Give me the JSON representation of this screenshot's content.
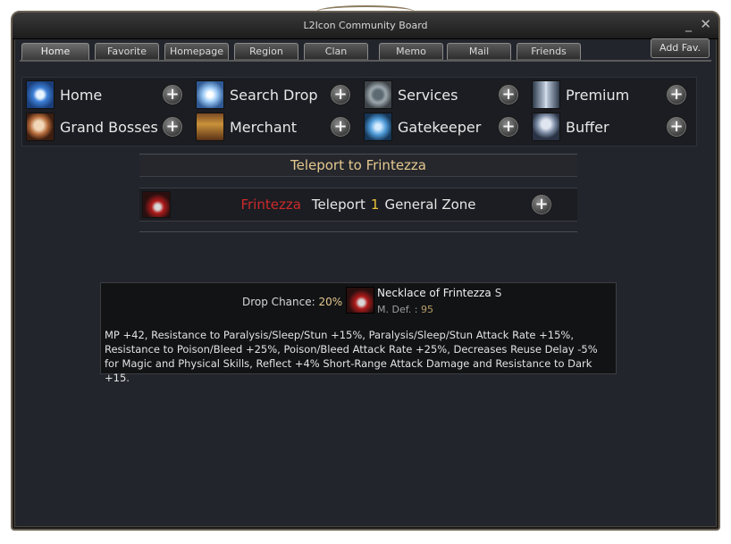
{
  "window": {
    "title": "L2Icon Community Board",
    "minimize_glyph": "_",
    "close_glyph": "✕"
  },
  "tabs": [
    {
      "label": "Home",
      "active": true
    },
    {
      "label": "Favorite"
    },
    {
      "label": "Homepage"
    },
    {
      "label": "Region"
    },
    {
      "label": "Clan"
    },
    {
      "label": "Memo"
    },
    {
      "label": "Mail"
    },
    {
      "label": "Friends"
    }
  ],
  "add_fav_label": "Add Fav.",
  "menu": [
    {
      "label": "Home",
      "icon": "home-icon"
    },
    {
      "label": "Search Drop",
      "icon": "search-drop-icon"
    },
    {
      "label": "Services",
      "icon": "services-icon"
    },
    {
      "label": "Premium",
      "icon": "premium-icon"
    },
    {
      "label": "Grand Bosses",
      "icon": "grand-bosses-icon"
    },
    {
      "label": "Merchant",
      "icon": "merchant-icon"
    },
    {
      "label": "Gatekeeper",
      "icon": "gatekeeper-icon"
    },
    {
      "label": "Buffer",
      "icon": "buffer-icon"
    }
  ],
  "plus_glyph": "+",
  "teleport": {
    "header": "Teleport to Frintezza",
    "boss": "Frintezza",
    "action": "Teleport",
    "count": "1",
    "zone": "General Zone"
  },
  "drop": {
    "label": "Drop Chance:",
    "chance": "20%",
    "item_name": "Necklace of Frintezza",
    "grade": "S",
    "stat_label": "M. Def. :",
    "stat_value": "95",
    "description_lines": [
      "MP +42, Resistance to Paralysis/Sleep/Stun +15%, Paralysis/Sleep/Stun Attack Rate +15%,",
      "Resistance to Poison/Bleed +25%, Poison/Bleed Attack Rate +25%, Decreases Reuse Delay -5%",
      "for Magic and Physical Skills, Reflect +4% Short-Range Attack Damage and Resistance to Dark +15."
    ]
  },
  "colors": {
    "boss_name": "#cc2a2a",
    "count_highlight": "#e8c13a",
    "header_gold": "#e6c98f"
  }
}
